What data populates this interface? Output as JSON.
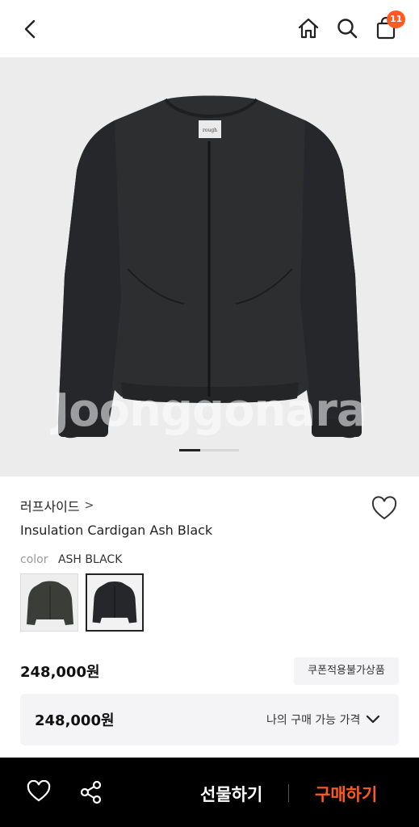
{
  "header": {
    "back_icon": "chevron-left-icon",
    "home_icon": "home-icon",
    "search_icon": "search-icon",
    "bag_icon": "shopping-bag-icon",
    "cart_count": "11",
    "badge_color": "#ff5a1f"
  },
  "hero": {
    "watermark": "Joonggonara",
    "image_index": 1
  },
  "product": {
    "brand": "러프사이드",
    "brand_chevron": ">",
    "name": "Insulation Cardigan Ash Black",
    "color_label": "color",
    "color_value": "ASH BLACK",
    "price": "248,000원",
    "coupon_tag": "쿠폰적용불가상품",
    "my_price": "248,000원",
    "my_price_label": "나의 구매 가능 가격"
  },
  "bottom": {
    "wish_icon": "heart-icon",
    "share_icon": "share-icon",
    "gift_label": "선물하기",
    "buy_label": "구매하기",
    "accent": "#ff5a1f"
  }
}
